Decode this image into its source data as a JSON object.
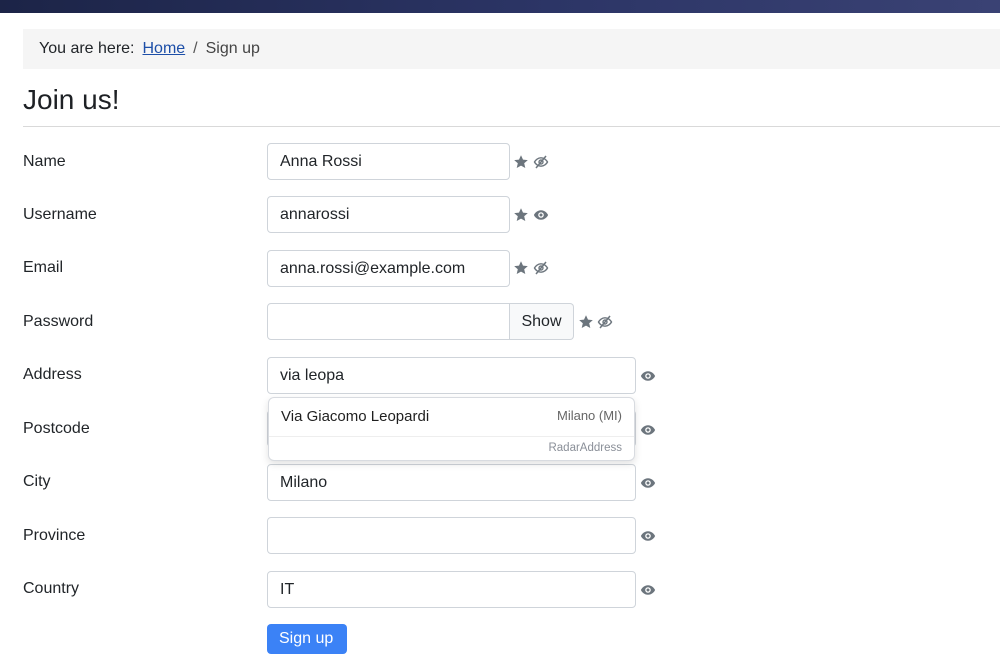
{
  "breadcrumb": {
    "prefix": "You are here:",
    "home": "Home",
    "separator": "/",
    "current": "Sign up"
  },
  "page_title": "Join us!",
  "fields": {
    "name": {
      "label": "Name",
      "value": "Anna Rossi"
    },
    "username": {
      "label": "Username",
      "value": "annarossi"
    },
    "email": {
      "label": "Email",
      "value": "anna.rossi@example.com"
    },
    "password": {
      "label": "Password",
      "value": "",
      "show_label": "Show"
    },
    "address": {
      "label": "Address",
      "value": "via leopa"
    },
    "postcode": {
      "label": "Postcode",
      "value": ""
    },
    "city": {
      "label": "City",
      "value": "Milano"
    },
    "province": {
      "label": "Province",
      "value": ""
    },
    "country": {
      "label": "Country",
      "value": "IT"
    }
  },
  "autocomplete": {
    "suggestion": "Via Giacomo Leopardi",
    "region": "Milano (MI)",
    "brand": "RadarAddress"
  },
  "submit_label": "Sign up",
  "icons": {
    "required": "star-icon",
    "visible": "eye-icon",
    "hidden": "eye-slash-icon"
  },
  "colors": {
    "accent": "#3b82f6",
    "icon": "#6c757d",
    "link": "#1d4fa8"
  }
}
